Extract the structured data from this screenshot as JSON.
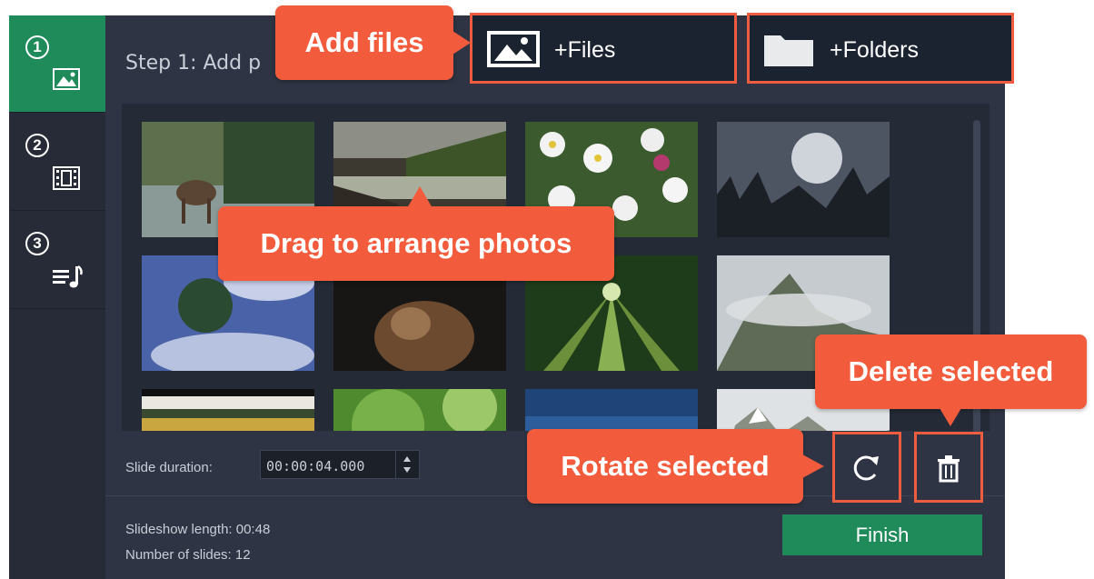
{
  "sidebar": {
    "steps": [
      {
        "number": "1",
        "icon": "photo-icon",
        "active": true
      },
      {
        "number": "2",
        "icon": "film-icon",
        "active": false
      },
      {
        "number": "3",
        "icon": "music-icon",
        "active": false
      }
    ]
  },
  "header": {
    "step_title": "Step 1: Add p",
    "files_label": "+Files",
    "folders_label": "+Folders"
  },
  "gallery": {
    "photos": [
      "elk-in-river",
      "mountain-river",
      "white-flowers",
      "misty-forest",
      "underwater-tree",
      "squirrel",
      "bamboo-forest",
      "foggy-mountain",
      "yellow-field",
      "green-leaves",
      "blue-sky",
      "snowy-peak"
    ]
  },
  "controls": {
    "duration_label": "Slide duration:",
    "duration_value": "00:00:04.000",
    "rotate_icon": "rotate-icon",
    "delete_icon": "trash-icon"
  },
  "stats": {
    "length_line": "Slideshow length: 00:48",
    "count_line": "Number of slides: 12"
  },
  "finish_label": "Finish",
  "callouts": {
    "add_files": "Add files",
    "drag": "Drag to arrange photos",
    "delete": "Delete selected",
    "rotate": "Rotate selected"
  },
  "colors": {
    "accent": "#1f8a5a",
    "callout": "#f25c3d",
    "background": "#2e3443"
  }
}
